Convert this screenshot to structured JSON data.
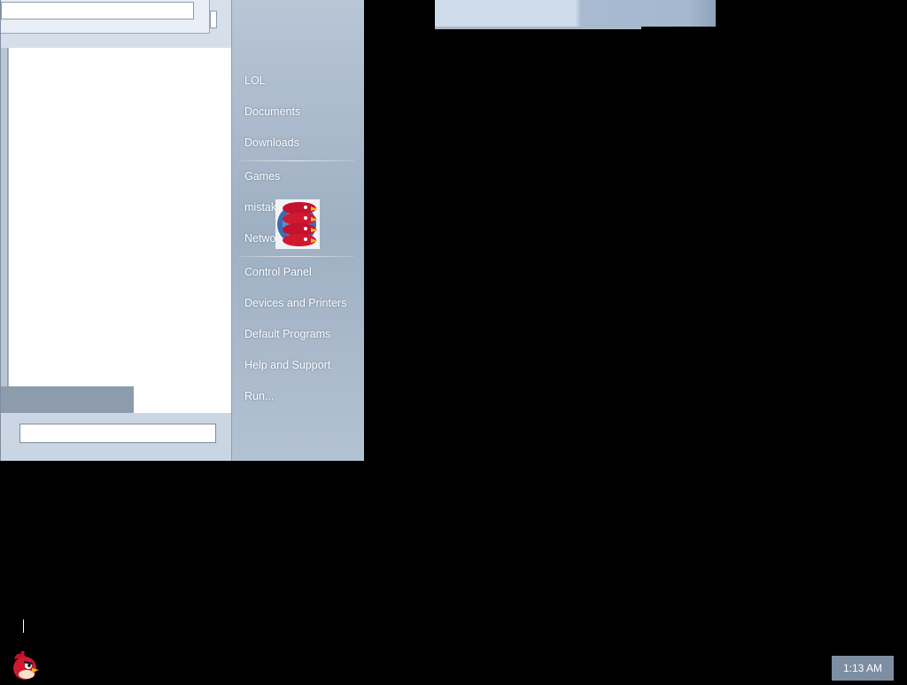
{
  "start_menu": {
    "right_items": [
      {
        "label": "LOL"
      },
      {
        "label": "Documents"
      },
      {
        "label": "Downloads"
      },
      {
        "label": "Games"
      },
      {
        "label": "mistak"
      },
      {
        "label": "Netwo"
      },
      {
        "label": "Control Panel"
      },
      {
        "label": "Devices and Printers"
      },
      {
        "label": "Default Programs"
      },
      {
        "label": "Help and Support"
      },
      {
        "label": "Run..."
      }
    ],
    "search": {
      "value": "",
      "placeholder": ""
    }
  },
  "overlay_icon": {
    "icon": "angry-birds-stacked-icon"
  },
  "taskbar": {
    "app_icon": "angry-bird-icon",
    "clock": "1:13 AM"
  },
  "colors": {
    "desktop": "#000000",
    "menu_frame": "#b7c5d4",
    "clock_bg": "#7d8ea2"
  }
}
